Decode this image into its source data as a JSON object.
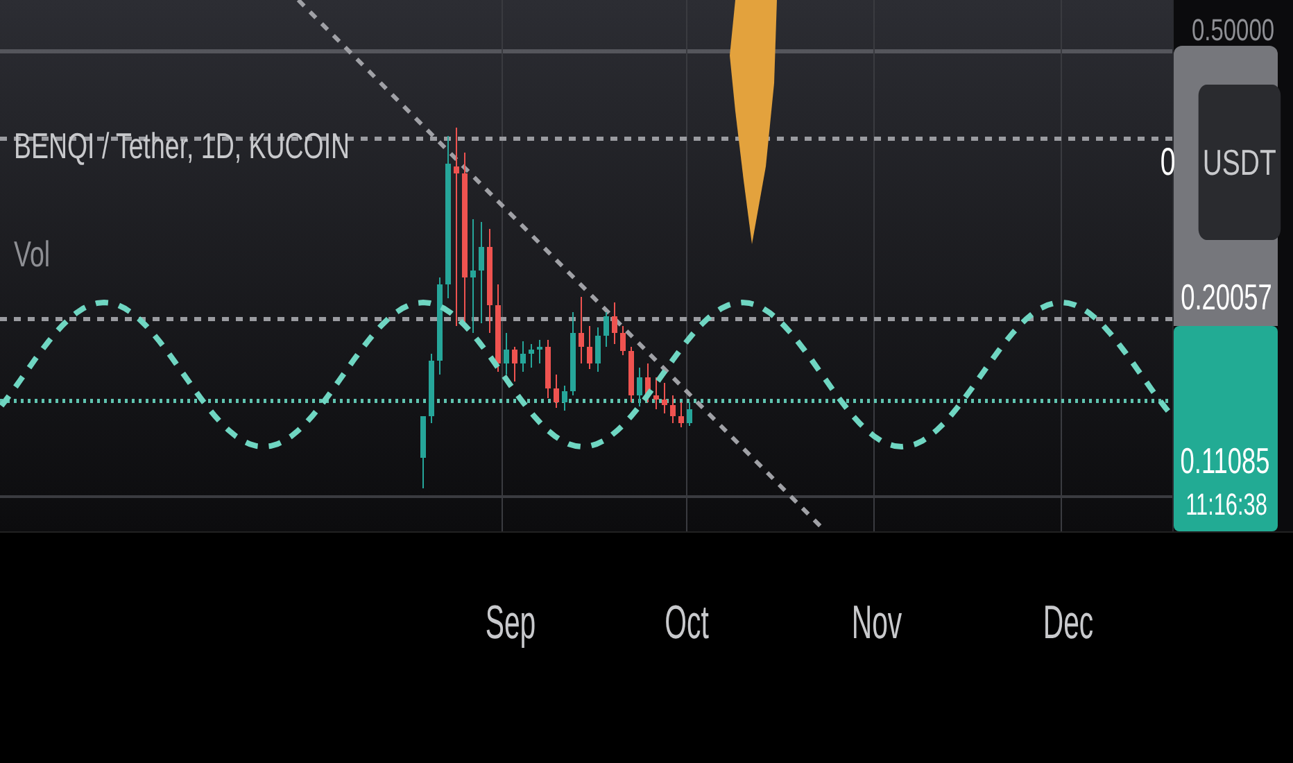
{
  "legend": {
    "symbol": "BENQI / Tether, 1D, KUCOIN",
    "indicator": "Vol"
  },
  "price_axis": {
    "top_label": "0.50000",
    "currency_prefix": "0",
    "currency_button": "USDT",
    "tags": [
      {
        "kind": "level",
        "value": "0.20057",
        "color": "#76777c"
      },
      {
        "kind": "last",
        "value": "0.11085",
        "countdown": "11:16:38",
        "color": "#22ab94"
      }
    ]
  },
  "time_axis": {
    "labels": [
      "Sep",
      "Oct",
      "Nov",
      "Dec"
    ]
  }
}
